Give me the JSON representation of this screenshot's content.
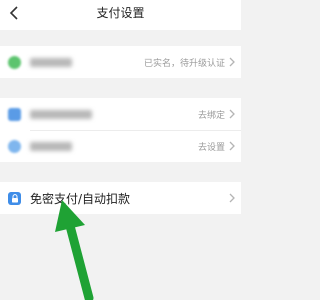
{
  "header": {
    "title": "支付设置",
    "back_icon": "chevron-left-icon"
  },
  "group1": {
    "items": [
      {
        "icon": "user-icon",
        "icon_color": "#5cc46e",
        "right_text": "已实名，待升级认证"
      }
    ]
  },
  "group2": {
    "items": [
      {
        "icon": "phone-icon",
        "icon_color": "#5a9be6",
        "right_text": "去绑定"
      },
      {
        "icon": "shield-icon",
        "icon_color": "#7fb6ee",
        "right_text": "去设置"
      }
    ]
  },
  "group3": {
    "items": [
      {
        "icon": "lock-icon",
        "icon_color": "#3f8de8",
        "label": "免密支付/自动扣款"
      }
    ]
  },
  "colors": {
    "accent_arrow": "#1fa234",
    "background": "#f2f2f2"
  }
}
